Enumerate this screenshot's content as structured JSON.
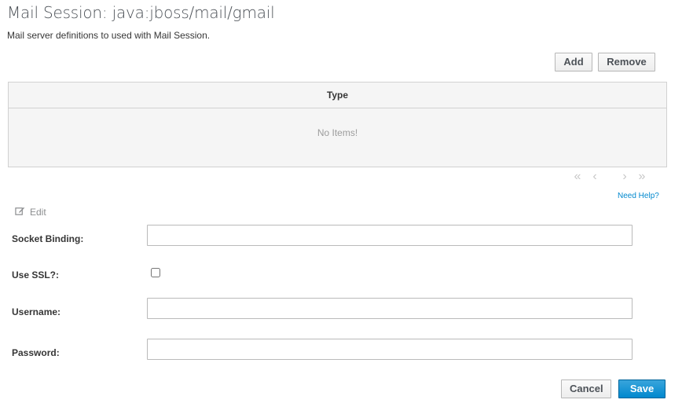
{
  "header": {
    "title": "Mail Session: java:jboss/mail/gmail",
    "description": "Mail server definitions to used with Mail Session."
  },
  "toolbar": {
    "add_label": "Add",
    "remove_label": "Remove"
  },
  "table": {
    "columns": [
      "Type"
    ],
    "empty_text": "No Items!"
  },
  "pager": {
    "first": "«",
    "prev": "‹",
    "next": "›",
    "last": "»"
  },
  "help_link": "Need Help?",
  "edit": {
    "label": "Edit",
    "icon": "edit-icon"
  },
  "form": {
    "socket_binding": {
      "label": "Socket Binding:",
      "value": ""
    },
    "use_ssl": {
      "label": "Use SSL?:",
      "checked": false
    },
    "username": {
      "label": "Username:",
      "value": ""
    },
    "password": {
      "label": "Password:",
      "value": ""
    }
  },
  "actions": {
    "cancel_label": "Cancel",
    "save_label": "Save"
  },
  "colors": {
    "primary": "#0088ce",
    "link": "#0088ce",
    "border": "#d1d1d1"
  }
}
